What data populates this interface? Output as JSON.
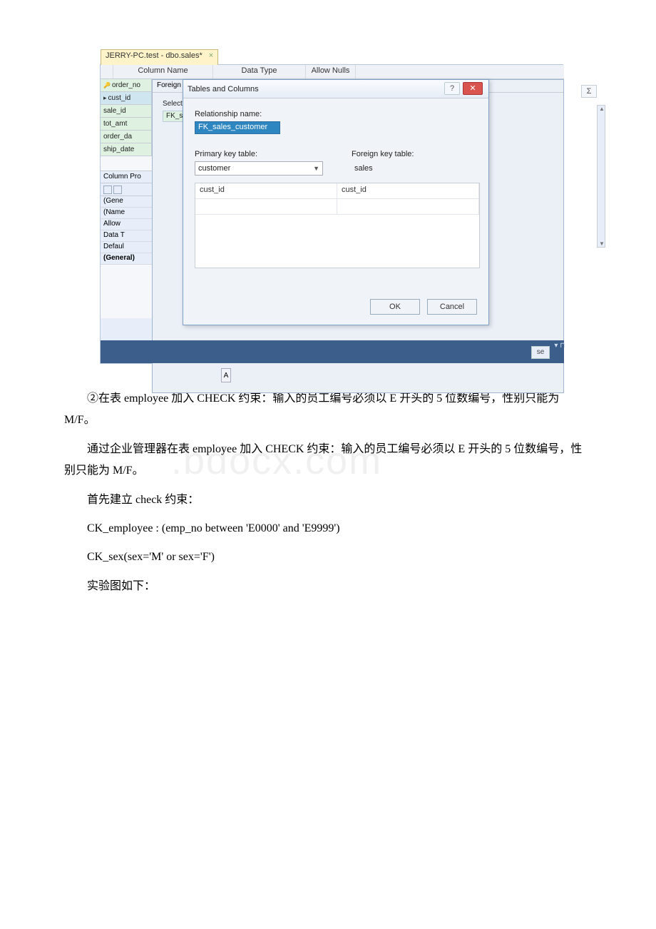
{
  "screenshot": {
    "tab_title": "JERRY-PC.test - dbo.sales*",
    "tab_close": "×",
    "grid_headers": {
      "col_name": "Column Name",
      "data_type": "Data Type",
      "allow_nulls": "Allow Nulls"
    },
    "rows": [
      "order_no",
      "cust_id",
      "sale_id",
      "tot_amt",
      "order_da",
      "ship_date"
    ],
    "fk_head": "Foreign K",
    "fk_selected_label": "Selecte",
    "fk_selected_value": "FK_sa",
    "col_props_title": "Column Pro",
    "props_items": {
      "general": "(Gene",
      "name": "(Name",
      "allow": "Allow",
      "datat": "Data T",
      "default": "Defaul",
      "general2": "(General)"
    },
    "btn_a": "A",
    "sigma": "Σ",
    "bottom_se": "se",
    "pin": "▾ ⊓"
  },
  "modal": {
    "title": "Tables and Columns",
    "help": "?",
    "close": "✕",
    "rel_label": "Relationship name:",
    "rel_value": "FK_sales_customer",
    "pk_label": "Primary key table:",
    "fk_label": "Foreign key table:",
    "pk_table": "customer",
    "fk_table": "sales",
    "pk_col": "cust_id",
    "fk_col": "cust_id",
    "ok": "OK",
    "cancel": "Cancel"
  },
  "doc": {
    "p1": "②在表 employee 加入 CHECK 约束：输入的员工编号必须以 E 开头的 5 位数编号，性别只能为 M/F。",
    "p2": "通过企业管理器在表 employee 加入 CHECK 约束：输入的员工编号必须以 E 开头的 5 位数编号，性别只能为 M/F。",
    "p3": "首先建立 check 约束：",
    "p4": "CK_employee : (emp_no between 'E0000' and 'E9999')",
    "p5": "CK_sex(sex='M' or sex='F')",
    "p6": "实验图如下："
  },
  "watermark": ".bdocx.com"
}
